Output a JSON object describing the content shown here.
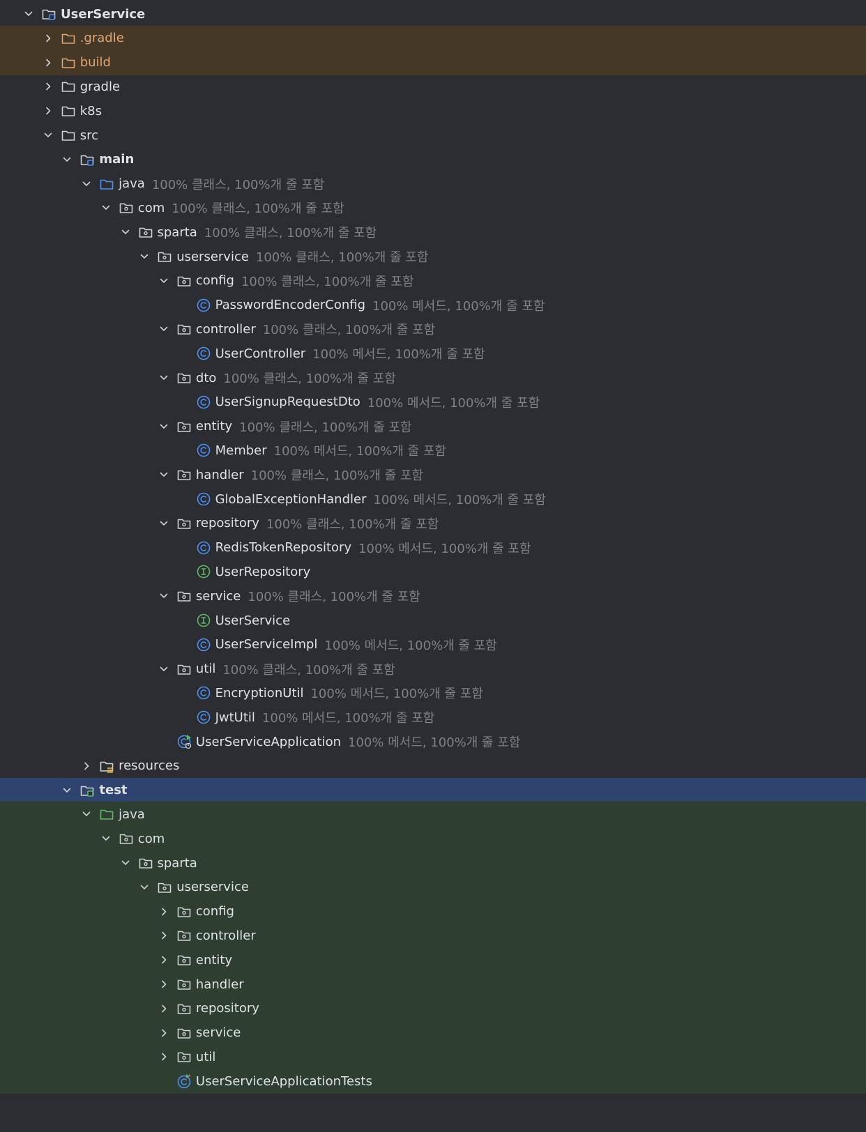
{
  "colors": {
    "background": "#2b2d30",
    "excluded_row": "#463827",
    "selected_row": "#2e436e",
    "test_row": "#2e3e31",
    "text": "#dfe1e5",
    "coverage_text": "#7e8188",
    "excluded_text": "#e0a571",
    "class_icon": "#4d8ff5",
    "interface_icon": "#5fb865",
    "source_folder": "#4d8ff5",
    "test_folder": "#5fb865"
  },
  "rows": [
    {
      "label": "UserService",
      "expanded": true,
      "icon": "module-folder-icon",
      "bold": true
    },
    {
      "label": ".gradle",
      "expanded": false,
      "icon": "excluded-folder-icon",
      "excluded": true
    },
    {
      "label": "build",
      "expanded": false,
      "icon": "excluded-folder-icon",
      "excluded": true
    },
    {
      "label": "gradle",
      "expanded": false,
      "icon": "folder-icon"
    },
    {
      "label": "k8s",
      "expanded": false,
      "icon": "folder-icon"
    },
    {
      "label": "src",
      "expanded": true,
      "icon": "folder-icon"
    },
    {
      "label": "main",
      "expanded": true,
      "icon": "source-root-module-icon",
      "bold": true
    },
    {
      "label": "java",
      "expanded": true,
      "icon": "source-folder-icon",
      "coverage": "100% 클래스, 100%개 줄 포함"
    },
    {
      "label": "com",
      "expanded": true,
      "icon": "package-icon",
      "coverage": "100% 클래스, 100%개 줄 포함"
    },
    {
      "label": "sparta",
      "expanded": true,
      "icon": "package-icon",
      "coverage": "100% 클래스, 100%개 줄 포함"
    },
    {
      "label": "userservice",
      "expanded": true,
      "icon": "package-icon",
      "coverage": "100% 클래스, 100%개 줄 포함"
    },
    {
      "label": "config",
      "expanded": true,
      "icon": "package-icon",
      "coverage": "100% 클래스, 100%개 줄 포함"
    },
    {
      "label": "PasswordEncoderConfig",
      "expanded": null,
      "icon": "class-icon",
      "coverage": "100% 메서드, 100%개 줄 포함"
    },
    {
      "label": "controller",
      "expanded": true,
      "icon": "package-icon",
      "coverage": "100% 클래스, 100%개 줄 포함"
    },
    {
      "label": "UserController",
      "expanded": null,
      "icon": "class-icon",
      "coverage": "100% 메서드, 100%개 줄 포함"
    },
    {
      "label": "dto",
      "expanded": true,
      "icon": "package-icon",
      "coverage": "100% 클래스, 100%개 줄 포함"
    },
    {
      "label": "UserSignupRequestDto",
      "expanded": null,
      "icon": "class-icon",
      "coverage": "100% 메서드, 100%개 줄 포함"
    },
    {
      "label": "entity",
      "expanded": true,
      "icon": "package-icon",
      "coverage": "100% 클래스, 100%개 줄 포함"
    },
    {
      "label": "Member",
      "expanded": null,
      "icon": "class-icon",
      "coverage": "100% 메서드, 100%개 줄 포함"
    },
    {
      "label": "handler",
      "expanded": true,
      "icon": "package-icon",
      "coverage": "100% 클래스, 100%개 줄 포함"
    },
    {
      "label": "GlobalExceptionHandler",
      "expanded": null,
      "icon": "class-icon",
      "coverage": "100% 메서드, 100%개 줄 포함"
    },
    {
      "label": "repository",
      "expanded": true,
      "icon": "package-icon",
      "coverage": "100% 클래스, 100%개 줄 포함"
    },
    {
      "label": "RedisTokenRepository",
      "expanded": null,
      "icon": "class-icon",
      "coverage": "100% 메서드, 100%개 줄 포함"
    },
    {
      "label": "UserRepository",
      "expanded": null,
      "icon": "interface-icon"
    },
    {
      "label": "service",
      "expanded": true,
      "icon": "package-icon",
      "coverage": "100% 클래스, 100%개 줄 포함"
    },
    {
      "label": "UserService",
      "expanded": null,
      "icon": "interface-icon"
    },
    {
      "label": "UserServiceImpl",
      "expanded": null,
      "icon": "class-icon",
      "coverage": "100% 메서드, 100%개 줄 포함"
    },
    {
      "label": "util",
      "expanded": true,
      "icon": "package-icon",
      "coverage": "100% 클래스, 100%개 줄 포함"
    },
    {
      "label": "EncryptionUtil",
      "expanded": null,
      "icon": "class-icon",
      "coverage": "100% 메서드, 100%개 줄 포함"
    },
    {
      "label": "JwtUtil",
      "expanded": null,
      "icon": "class-icon",
      "coverage": "100% 메서드, 100%개 줄 포함"
    },
    {
      "label": "UserServiceApplication",
      "expanded": null,
      "icon": "spring-boot-class-icon",
      "coverage": "100% 메서드, 100%개 줄 포함"
    },
    {
      "label": "resources",
      "expanded": false,
      "icon": "resources-folder-icon"
    },
    {
      "label": "test",
      "expanded": true,
      "icon": "test-module-folder-icon",
      "bold": true,
      "selected": true
    },
    {
      "label": "java",
      "expanded": true,
      "icon": "test-source-folder-icon",
      "test": true
    },
    {
      "label": "com",
      "expanded": true,
      "icon": "package-icon",
      "test": true
    },
    {
      "label": "sparta",
      "expanded": true,
      "icon": "package-icon",
      "test": true
    },
    {
      "label": "userservice",
      "expanded": true,
      "icon": "package-icon",
      "test": true
    },
    {
      "label": "config",
      "expanded": false,
      "icon": "package-icon",
      "test": true
    },
    {
      "label": "controller",
      "expanded": false,
      "icon": "package-icon",
      "test": true
    },
    {
      "label": "entity",
      "expanded": false,
      "icon": "package-icon",
      "test": true
    },
    {
      "label": "handler",
      "expanded": false,
      "icon": "package-icon",
      "test": true
    },
    {
      "label": "repository",
      "expanded": false,
      "icon": "package-icon",
      "test": true
    },
    {
      "label": "service",
      "expanded": false,
      "icon": "package-icon",
      "test": true
    },
    {
      "label": "util",
      "expanded": false,
      "icon": "package-icon",
      "test": true
    },
    {
      "label": "UserServiceApplicationTests",
      "expanded": null,
      "icon": "test-class-icon",
      "test": true
    }
  ]
}
